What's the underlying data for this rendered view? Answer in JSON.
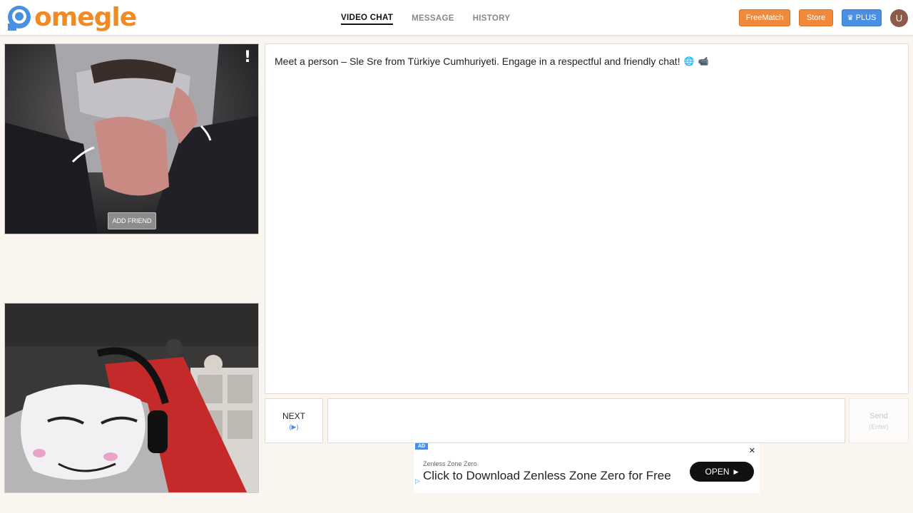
{
  "brand": {
    "name": "omegle",
    "color": "#f08a24"
  },
  "nav": {
    "tabs": [
      {
        "label": "VIDEO CHAT",
        "active": true
      },
      {
        "label": "MESSAGE",
        "active": false
      },
      {
        "label": "HISTORY",
        "active": false
      }
    ]
  },
  "header_buttons": {
    "freematch": "FreeMatch",
    "store": "Store",
    "plus": "PLUS",
    "avatar_initial": "U"
  },
  "stranger_video": {
    "report_icon": "!",
    "add_friend_label": "ADD FRIEND"
  },
  "chat": {
    "intro_message": "Meet a person – Sle Sre from Türkiye Cumhuriyeti. Engage in a respectful and friendly chat!",
    "intro_icons": [
      "globe-icon",
      "camera-icon"
    ]
  },
  "controls": {
    "next_label": "NEXT",
    "next_hint": "(▶)",
    "message_value": "",
    "send_label": "Send",
    "send_hint": "(Enter)"
  },
  "ad": {
    "badge": "AD",
    "close": "✕",
    "advertiser": "Zenless Zone Zero",
    "headline": "Click to Download Zenless Zone Zero for Free",
    "cta": "OPEN"
  },
  "colors": {
    "accent_orange": "#f08a3a",
    "accent_blue": "#4a90e2",
    "background": "#faf5ee"
  }
}
